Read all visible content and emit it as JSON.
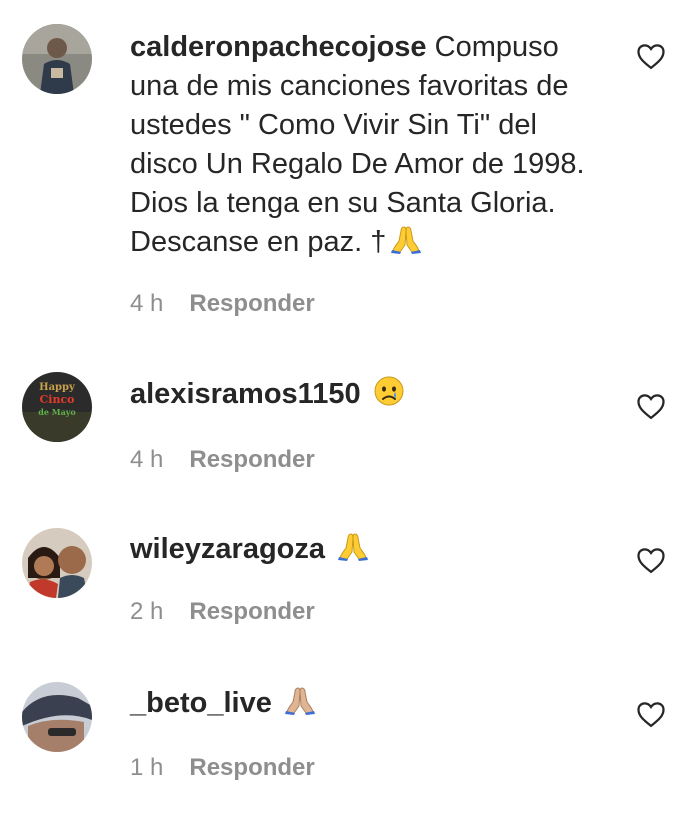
{
  "comments": [
    {
      "username": "calderonpachecojose",
      "text": "Compuso una de mis canciones favoritas de ustedes \" Como Vivir Sin Ti\" del disco Un Regalo De Amor de 1998. Dios la tenga en su Santa Gloria. Descanse en paz. †",
      "emoji": "folded-hands",
      "time": "4 h",
      "reply_label": "Responder"
    },
    {
      "username": "alexisramos1150",
      "text": "",
      "emoji": "crying-face",
      "time": "4 h",
      "reply_label": "Responder",
      "avatar_text": [
        "Happy",
        "Cinco",
        "de Mayo"
      ]
    },
    {
      "username": "wileyzaragoza",
      "text": "",
      "emoji": "folded-hands",
      "time": "2 h",
      "reply_label": "Responder"
    },
    {
      "username": "_beto_live",
      "text": "",
      "emoji": "folded-hands-medium-skin",
      "time": "1 h",
      "reply_label": "Responder"
    }
  ],
  "colors": {
    "text": "#262626",
    "meta": "#8e8e8e",
    "heart_stroke": "#262626",
    "emoji_yellow": "#ffcc33"
  }
}
